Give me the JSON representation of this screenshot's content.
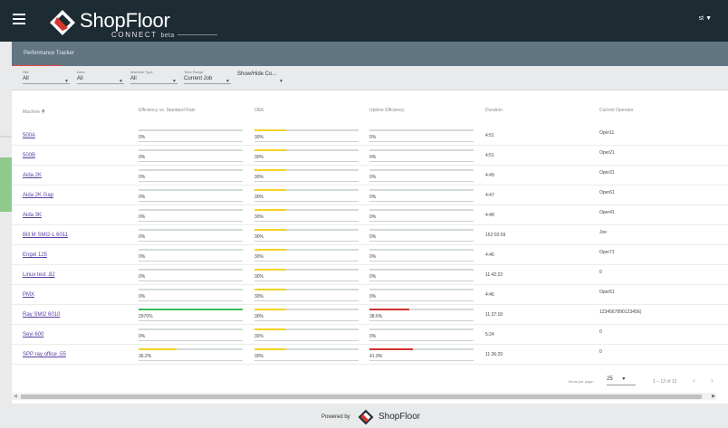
{
  "header": {
    "brand_shop": "Shop",
    "brand_floor": "Floor",
    "brand_sub": "CONNECT",
    "brand_beta": "beta",
    "user_label": "st"
  },
  "panel": {
    "title": "Performance Tracker"
  },
  "filters": [
    {
      "label": "Site",
      "value": "All"
    },
    {
      "label": "Area",
      "value": "All"
    },
    {
      "label": "Machine Type",
      "value": "All"
    },
    {
      "label": "Time Range",
      "value": "Current Job"
    },
    {
      "label": "",
      "value": "Show/Hide Co..."
    }
  ],
  "table": {
    "columns": [
      "Machine",
      "Efficiency vs. Standard Rate",
      "OEE",
      "Uptime Efficiency",
      "Duration",
      "Current Operator"
    ],
    "sort_icon": "arrow-up-icon",
    "rows": [
      {
        "machine": "500A",
        "eff": "0%",
        "eff_pct": 0,
        "oee": "30%",
        "oee_pct": 30,
        "up": "0%",
        "up_pct": 0,
        "duration": "4:51",
        "operator": "Oper11"
      },
      {
        "machine": "500B",
        "eff": "0%",
        "eff_pct": 0,
        "oee": "30%",
        "oee_pct": 30,
        "up": "0%",
        "up_pct": 0,
        "duration": "4:51",
        "operator": "Oper21"
      },
      {
        "machine": "Aida 2K",
        "eff": "0%",
        "eff_pct": 0,
        "oee": "30%",
        "oee_pct": 30,
        "up": "0%",
        "up_pct": 0,
        "duration": "4:49",
        "operator": "Oper31"
      },
      {
        "machine": "Aida 2K Gap",
        "eff": "0%",
        "eff_pct": 0,
        "oee": "30%",
        "oee_pct": 30,
        "up": "0%",
        "up_pct": 0,
        "duration": "4:47",
        "operator": "Oper61"
      },
      {
        "machine": "Aida 3K",
        "eff": "0%",
        "eff_pct": 0,
        "oee": "30%",
        "oee_pct": 30,
        "up": "0%",
        "up_pct": 0,
        "duration": "4:48",
        "operator": "Oper41"
      },
      {
        "machine": "Bill M SMI2-L 6011",
        "eff": "0%",
        "eff_pct": 0,
        "oee": "30%",
        "oee_pct": 30,
        "up": "0%",
        "up_pct": 0,
        "duration": "152:02:09",
        "operator": "Joe"
      },
      {
        "machine": "Engel 125",
        "eff": "0%",
        "eff_pct": 0,
        "oee": "30%",
        "oee_pct": 30,
        "up": "0%",
        "up_pct": 0,
        "duration": "4:46",
        "operator": "Oper71"
      },
      {
        "machine": "Linux test .82",
        "eff": "0%",
        "eff_pct": 0,
        "oee": "30%",
        "oee_pct": 30,
        "up": "0%",
        "up_pct": 0,
        "duration": "11:42:23",
        "operator": "0"
      },
      {
        "machine": "PMX",
        "eff": "0%",
        "eff_pct": 0,
        "oee": "30%",
        "oee_pct": 30,
        "up": "0%",
        "up_pct": 0,
        "duration": "4:46",
        "operator": "Oper51"
      },
      {
        "machine": "Ray SMI2 6010",
        "eff": "2970%",
        "eff_pct": 100,
        "oee": "30%",
        "oee_pct": 30,
        "up": "38.6%",
        "up_pct": 38.6,
        "duration": "11:37:18",
        "operator": "1234567890123456("
      },
      {
        "machine": "Seyi 600",
        "eff": "0%",
        "eff_pct": 0,
        "oee": "30%",
        "oee_pct": 30,
        "up": "0%",
        "up_pct": 0,
        "duration": "5:24",
        "operator": "0"
      },
      {
        "machine": "SPP ray office .55",
        "eff": "36.2%",
        "eff_pct": 36.2,
        "oee": "30%",
        "oee_pct": 30,
        "up": "41.9%",
        "up_pct": 41.9,
        "duration": "11:36:29",
        "operator": "0"
      }
    ]
  },
  "paginator": {
    "items_per_page_label": "Items per page:",
    "items_per_page": "25",
    "range": "1 – 12 of 12"
  },
  "footer": {
    "powered_by": "Powered by",
    "brand": "ShopFloor"
  },
  "colors": {
    "topbar": "#1d2b33",
    "panel_header": "#617583",
    "bar_green": "#3cba54",
    "bar_yellow": "#f4d21f",
    "bar_red": "#d0302a",
    "link": "#5a3fa2"
  }
}
